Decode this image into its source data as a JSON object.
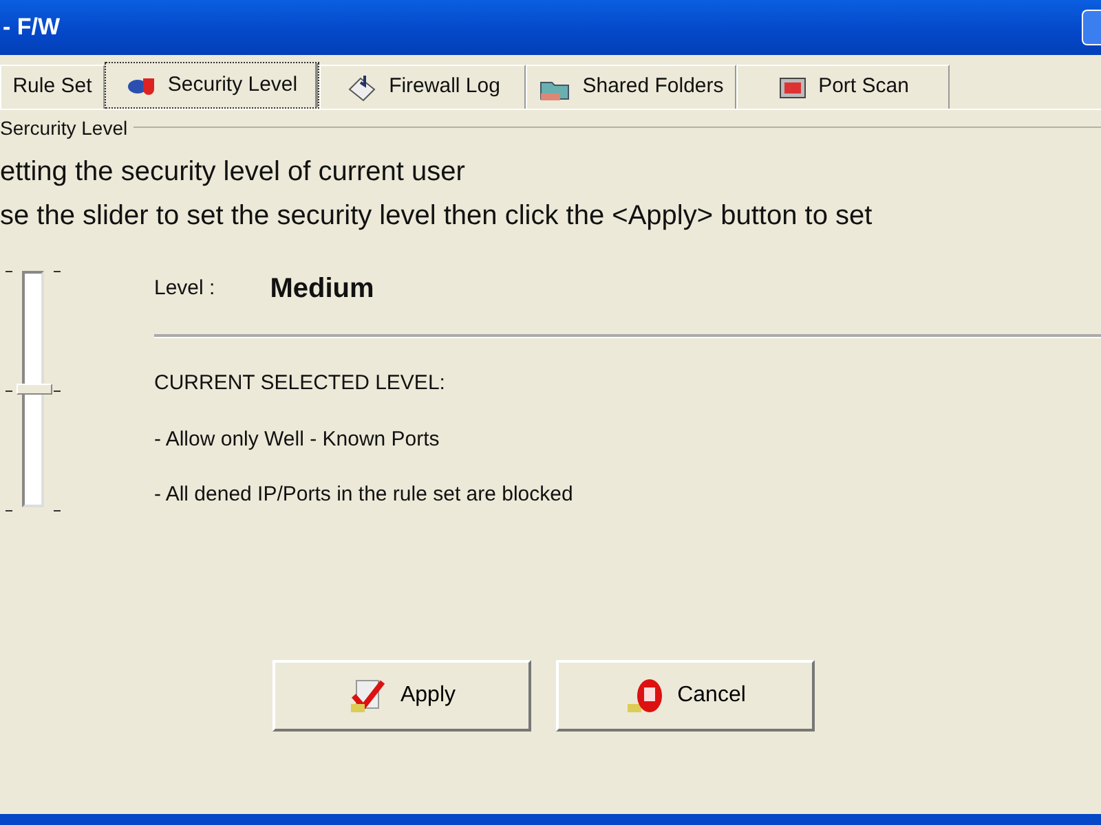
{
  "window": {
    "title": "- F/W"
  },
  "tabs": [
    {
      "label": "Rule Set",
      "selected": false,
      "kind": "plain"
    },
    {
      "label": "Security Level",
      "selected": true,
      "kind": "shield"
    },
    {
      "label": "Firewall Log",
      "selected": false,
      "kind": "log"
    },
    {
      "label": "Shared Folders",
      "selected": false,
      "kind": "folder"
    },
    {
      "label": "Port Scan",
      "selected": false,
      "kind": "monitor"
    }
  ],
  "group": {
    "title": "Sercurity Level",
    "instructions": [
      "etting the security level of current user",
      "se the slider to set the security level then click the <Apply> button to set"
    ],
    "slider": {
      "level": 0.5
    },
    "level_label": "Level :",
    "level_value": "Medium",
    "details": [
      "CURRENT SELECTED LEVEL:",
      "- Allow only Well - Known Ports",
      "- All dened IP/Ports in the rule set are blocked"
    ]
  },
  "buttons": [
    {
      "label": "Apply",
      "kind": "apply"
    },
    {
      "label": "Cancel",
      "kind": "cancel"
    }
  ]
}
